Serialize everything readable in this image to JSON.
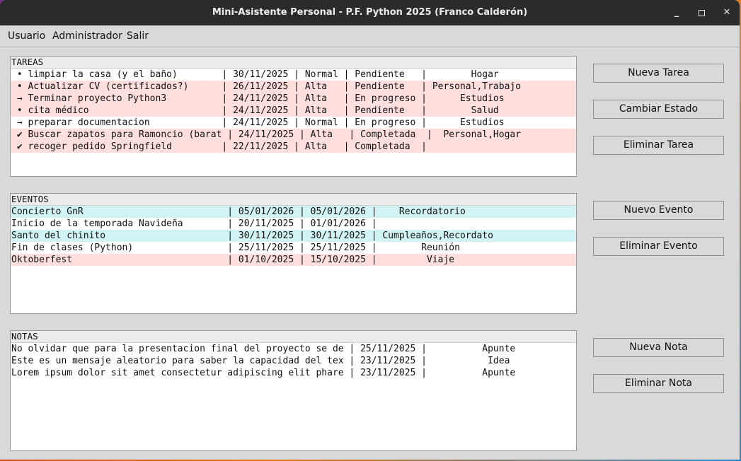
{
  "window": {
    "title": "Mini-Asistente Personal - P.F. Python 2025 (Franco Calderón)",
    "controls": {
      "minimize": "_",
      "close": "✕"
    }
  },
  "menu": [
    "Usuario",
    "Administrador",
    "Salir"
  ],
  "tareas": {
    "header": "TAREAS",
    "rows": [
      {
        "text": " • limpiar la casa (y el baño)        | 30/11/2025 | Normal | Pendiente   |        Hogar",
        "color": "white"
      },
      {
        "text": " • Actualizar CV (certificados?)      | 26/11/2025 | Alta   | Pendiente   | Personal,Trabajo",
        "color": "pink"
      },
      {
        "text": " → Terminar proyecto Python3          | 24/11/2025 | Alta   | En progreso |      Estudios",
        "color": "pink"
      },
      {
        "text": " • cita médico                        | 24/11/2025 | Alta   | Pendiente   |        Salud",
        "color": "pink"
      },
      {
        "text": " → preparar documentacion             | 24/11/2025 | Normal | En progreso |      Estudios",
        "color": "white"
      },
      {
        "text": " ✔ Buscar zapatos para Ramoncio (barat | 24/11/2025 | Alta   | Completada  |  Personal,Hogar",
        "color": "pink"
      },
      {
        "text": " ✔ recoger pedido Springfield         | 22/11/2025 | Alta   | Completada  |",
        "color": "pink"
      }
    ],
    "buttons": [
      "Nueva Tarea",
      "Cambiar Estado",
      "Eliminar Tarea"
    ]
  },
  "eventos": {
    "header": "EVENTOS",
    "rows": [
      {
        "text": "Concierto GnR                          | 05/01/2026 | 05/01/2026 |    Recordatorio",
        "color": "cyan"
      },
      {
        "text": "Inicio de la temporada Navideña        | 20/11/2025 | 01/01/2026 |",
        "color": "white"
      },
      {
        "text": "Santo del chinito                      | 30/11/2025 | 30/11/2025 | Cumpleaños,Recordato",
        "color": "cyan"
      },
      {
        "text": "Fin de clases (Python)                 | 25/11/2025 | 25/11/2025 |        Reunión",
        "color": "white"
      },
      {
        "text": "Oktoberfest                            | 01/10/2025 | 15/10/2025 |         Viaje",
        "color": "pink"
      }
    ],
    "buttons": [
      "Nuevo Evento",
      "Eliminar Evento"
    ]
  },
  "notas": {
    "header": "NOTAS",
    "rows": [
      {
        "text": "No olvidar que para la presentacion final del proyecto se de | 25/11/2025 |          Apunte",
        "color": "white"
      },
      {
        "text": "Este es un mensaje aleatorio para saber la capacidad del tex | 23/11/2025 |           Idea",
        "color": "white"
      },
      {
        "text": "Lorem ipsum dolor sit amet consectetur adipiscing elit phare | 23/11/2025 |          Apunte",
        "color": "white"
      }
    ],
    "buttons": [
      "Nueva Nota",
      "Eliminar Nota"
    ]
  }
}
